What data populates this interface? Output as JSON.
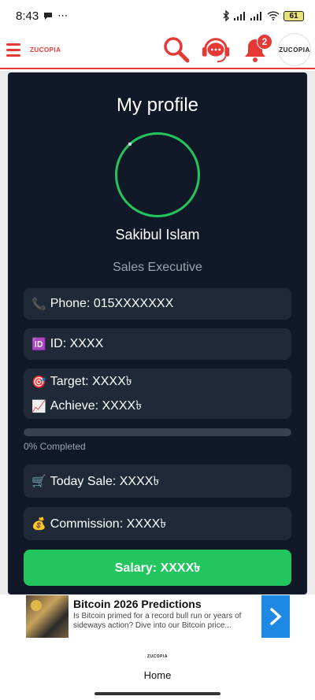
{
  "status_bar": {
    "time": "8:43",
    "battery": "61",
    "icons": [
      "chat-bubble-icon",
      "more-dots-icon",
      "bluetooth-icon",
      "signal-icon",
      "signal-icon",
      "wifi-icon",
      "battery-icon"
    ]
  },
  "header": {
    "brand": "ZUCOPIA",
    "menu_icon": "hamburger-icon",
    "search_icon": "search-icon",
    "support_icon": "support-headset-icon",
    "notification_icon": "bell-icon",
    "notification_count": "2",
    "avatar_brand": "ZUCOPIA",
    "accent_color": "#e53935"
  },
  "profile": {
    "title": "My profile",
    "name": "Sakibul Islam",
    "role": "Sales Executive",
    "phone": "Phone: 015XXXXXXX",
    "id": "ID: XXXX",
    "target": "Target: XXXX৳",
    "achieve": "Achieve: XXXX৳",
    "progress_percent": 0,
    "progress_label": "0% Completed",
    "today_sale": "Today Sale: XXXX৳",
    "commission": "Commission: XXXX৳",
    "salary": "Salary: XXXX৳",
    "emoji": {
      "phone": "📞",
      "id": "🆔",
      "target": "🎯",
      "achieve": "📈",
      "sale": "🛒",
      "commission": "💰"
    },
    "colors": {
      "card_bg": "#111827",
      "box_bg": "#1f2937",
      "accent_green": "#22c55e"
    }
  },
  "ad": {
    "title": "Bitcoin 2026 Predictions",
    "description": "Is Bitcoin primed for a record bull run or years of sideways action? Dive into our Bitcoin price...",
    "arrow_icon": "chevron-right-icon"
  },
  "bottom_nav": {
    "logo": "ZUCOPIA",
    "label": "Home"
  }
}
